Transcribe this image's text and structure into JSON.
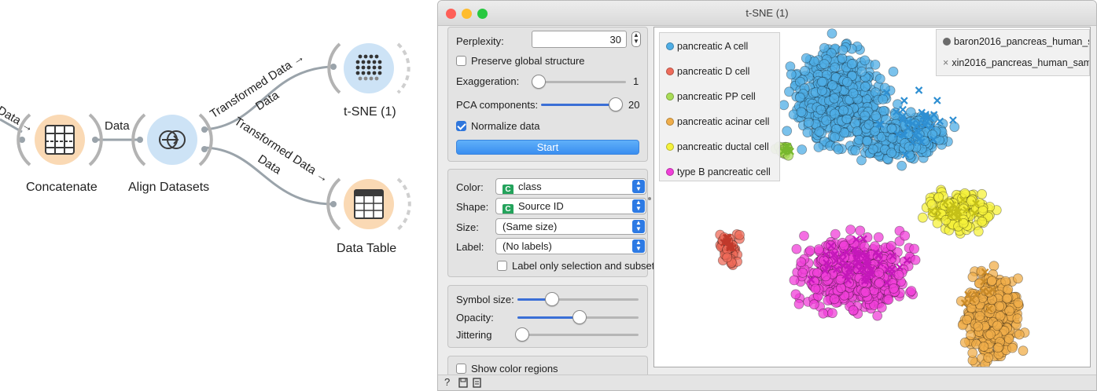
{
  "workflow": {
    "link_texts": {
      "incoming": "Data →",
      "concat_to_align": "Data",
      "align_to_tsne_top": "Transformed Data →",
      "align_to_tsne_bottom": "Data",
      "align_to_table_top": "Transformed Data →",
      "align_to_table_bottom": "Data"
    },
    "widgets": {
      "concatenate": "Concatenate",
      "align": "Align Datasets",
      "tsne": "t-SNE (1)",
      "table": "Data Table"
    },
    "colors": {
      "orange": "#fad9b4",
      "blue": "#cde3f6",
      "link": "#9aa3aa"
    }
  },
  "window": {
    "title": "t-SNE (1)",
    "traffic_colors": [
      "#fe5f57",
      "#febc2e",
      "#28c840"
    ]
  },
  "params": {
    "perplexity_label": "Perplexity:",
    "perplexity_value": "30",
    "preserve_label": "Preserve global structure",
    "preserve_checked": false,
    "exaggeration_label": "Exaggeration:",
    "exaggeration_value": "1",
    "exaggeration_fraction": 0.0,
    "pca_label": "PCA components:",
    "pca_value": "20",
    "pca_fraction": 1.0,
    "normalize_label": "Normalize data",
    "normalize_checked": true,
    "start_label": "Start"
  },
  "attributes": {
    "color_label": "Color:",
    "color_value": "class",
    "color_badge": "C",
    "shape_label": "Shape:",
    "shape_value": "Source ID",
    "shape_badge": "C",
    "size_label": "Size:",
    "size_value": "(Same size)",
    "label_label": "Label:",
    "label_value": "(No labels)",
    "label_only_text": "Label only selection and subset",
    "label_only_checked": false
  },
  "display": {
    "symbol_size_label": "Symbol size:",
    "symbol_size_fraction": 0.28,
    "opacity_label": "Opacity:",
    "opacity_fraction": 0.5,
    "jittering_label": "Jittering",
    "jittering_fraction": 0.0
  },
  "regions": {
    "show_color_regions_label": "Show color regions",
    "checked": false
  },
  "legend_classes": [
    {
      "name": "pancreatic A cell",
      "color": "#4faee6"
    },
    {
      "name": "pancreatic D cell",
      "color": "#ef6b5a"
    },
    {
      "name": "pancreatic PP cell",
      "color": "#a9dd57"
    },
    {
      "name": "pancreatic acinar cell",
      "color": "#f0ae4a"
    },
    {
      "name": "pancreatic ductal cell",
      "color": "#f5f23b"
    },
    {
      "name": "type B pancreatic cell",
      "color": "#f03fd8"
    }
  ],
  "legend_sources": [
    {
      "name": "baron2016_pancreas_human_s",
      "symbol": "circle"
    },
    {
      "name": "xin2016_pancreas_human_sam",
      "symbol": "cross"
    }
  ],
  "statusbar": {
    "help_icon": "?",
    "save_icon": "save-icon",
    "report_icon": "report-icon"
  }
}
